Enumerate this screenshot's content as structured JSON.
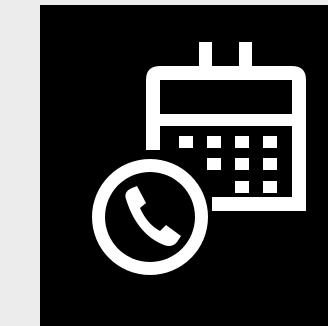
{
  "icon": {
    "name": "calendar-phone-icon",
    "background_color": "#000000",
    "page_background_color": "#ececec",
    "foreground_color": "#ffffff"
  }
}
